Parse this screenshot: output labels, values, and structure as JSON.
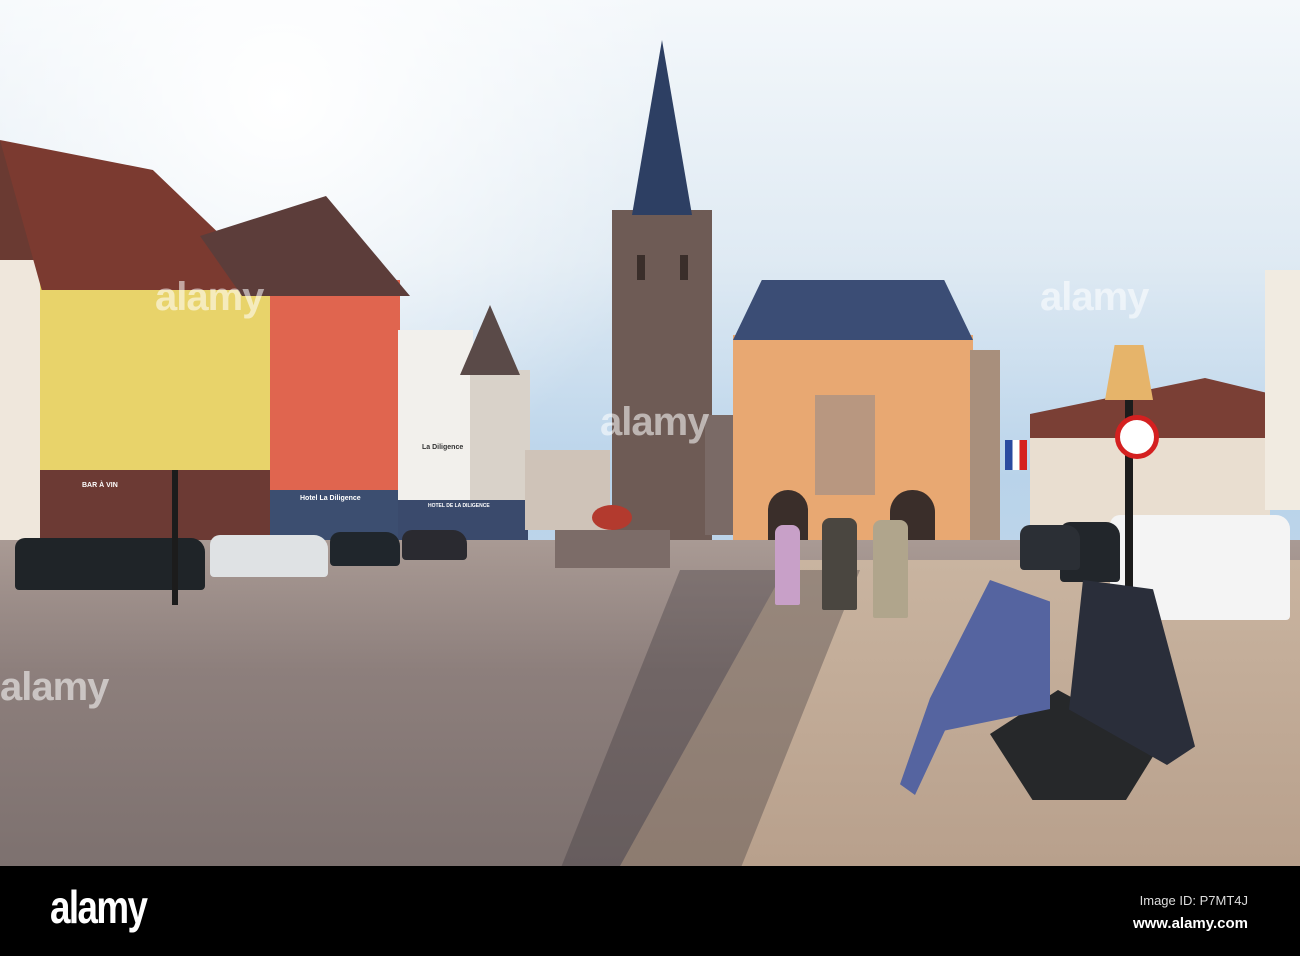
{
  "photo": {
    "signs": {
      "bar_a_vin": "BAR À VIN",
      "hotel_diligence": "Hotel La Diligence",
      "la_diligence": "La Diligence",
      "hotel_de_la_diligence": "HOTEL DE LA DILIGENCE"
    },
    "watermark": "alamy",
    "colors": {
      "sky": "#c9dcec",
      "yellow_house": "#e8d36a",
      "red_house": "#e0654f",
      "town_hall": "#e8a872",
      "tower": "#6e5b55"
    }
  },
  "footer": {
    "logo": "alamy",
    "image_id": "Image ID: P7MT4J",
    "url": "www.alamy.com"
  }
}
